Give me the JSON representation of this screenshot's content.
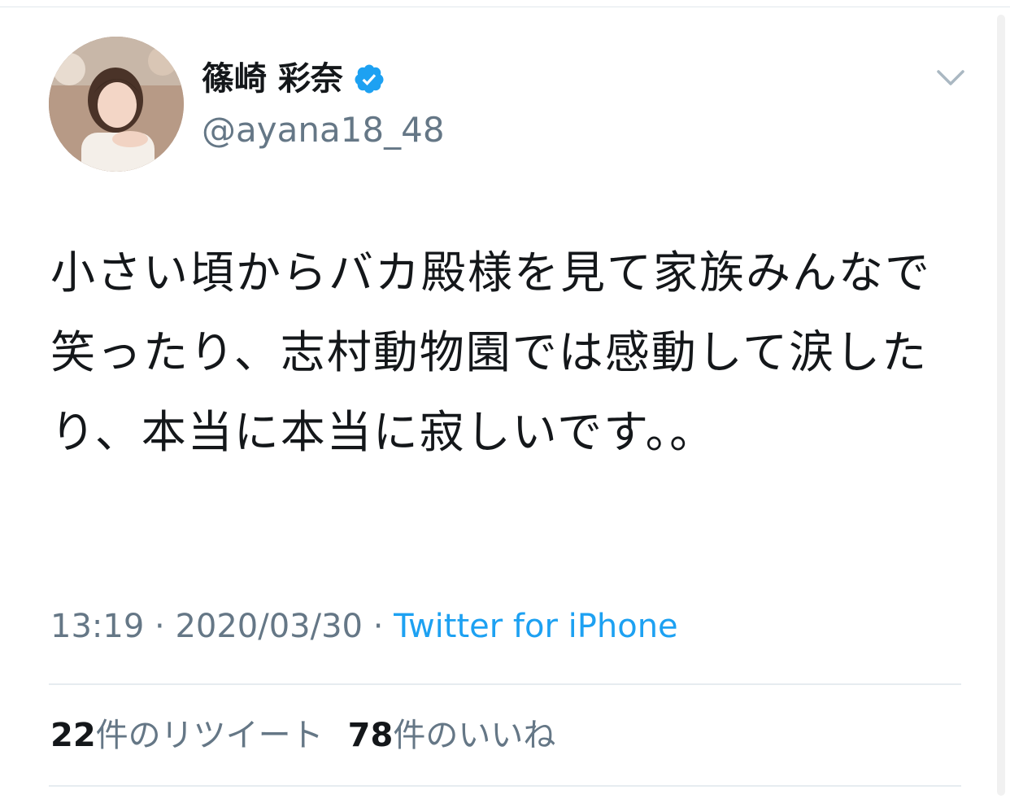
{
  "tweet": {
    "author": {
      "display_name": "篠崎 彩奈",
      "handle": "@ayana18_48",
      "verified": true
    },
    "text": "小さい頃からバカ殿様を見て家族みんなで笑ったり、志村動物園では感動して涙したり、本当に本当に寂しいです。。",
    "meta": {
      "time": "13:19",
      "separator": " · ",
      "date": "2020/03/30",
      "source": "Twitter for iPhone"
    },
    "stats": {
      "retweets_count": "22",
      "retweets_label": "件のリツイート",
      "likes_count": "78",
      "likes_label": "件のいいね"
    }
  },
  "colors": {
    "accent": "#1da1f2",
    "text_primary": "#14171a",
    "text_secondary": "#657786",
    "divider": "#e6ecf0"
  },
  "icons": {
    "verified": "verified-badge-icon",
    "menu": "chevron-down-icon"
  }
}
